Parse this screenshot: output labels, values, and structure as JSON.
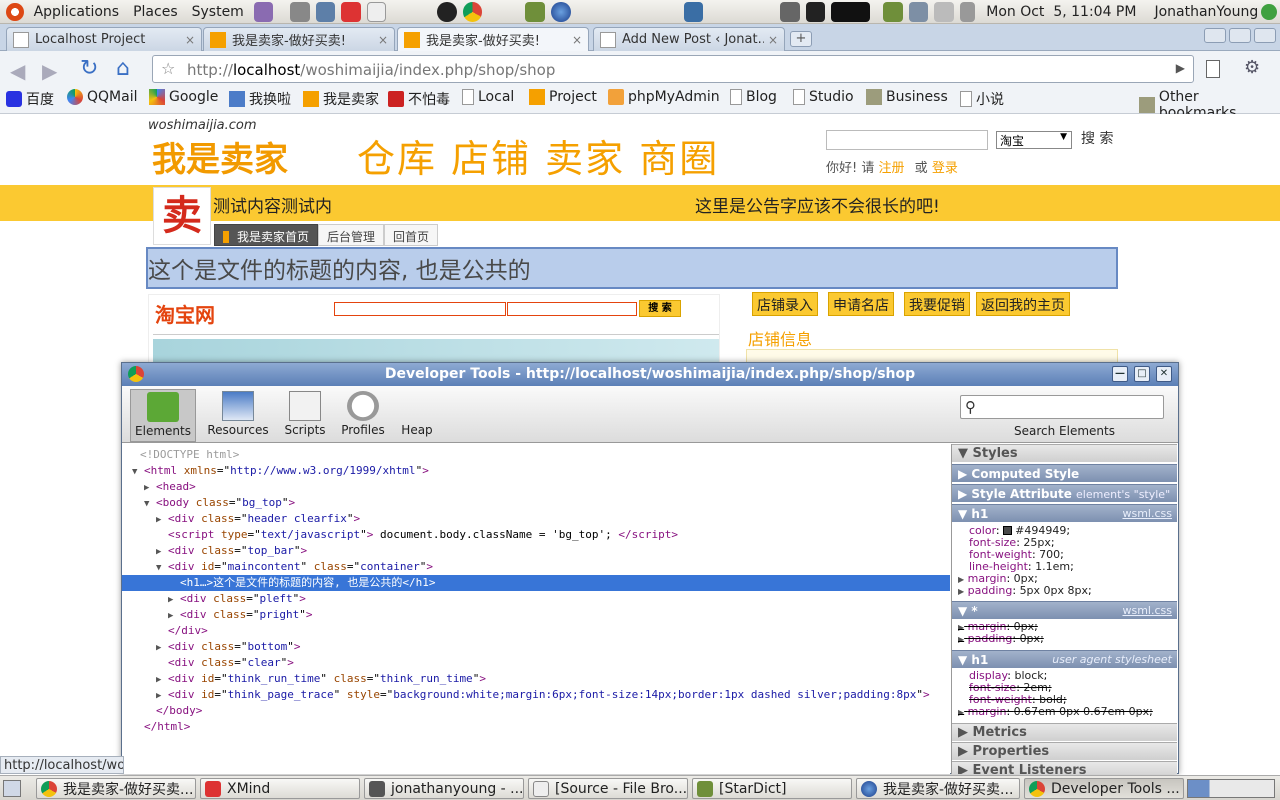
{
  "panel": {
    "menus": [
      "Applications",
      "Places",
      "System"
    ],
    "clock": "Mon Oct  5, 11:04 PM",
    "user": "JonathanYoung"
  },
  "tabs": [
    {
      "title": "Localhost Project",
      "close": "×"
    },
    {
      "title": "我是卖家-做好买卖!",
      "close": "×"
    },
    {
      "title": "我是卖家-做好买卖!",
      "close": "×"
    },
    {
      "title": "Add New Post ‹ Jonat…",
      "close": "×"
    }
  ],
  "omnibox": {
    "url_pre": "http://",
    "url_host": "localhost",
    "url_path": "/woshimaijia/index.php/shop/shop"
  },
  "bookmarks": [
    "百度",
    "QQMail",
    "Google",
    "我换啦",
    "我是卖家",
    "不怕毒",
    "Local",
    "Project",
    "phpMyAdmin",
    "Blog",
    "Studio",
    "Business",
    "小说"
  ],
  "other_bookmarks": "Other bookmarks",
  "site": {
    "logo_small": "woshimaijia.com",
    "logo_big": "我是卖家",
    "nav": "仓库 店铺 卖家 商圈",
    "search_select": "淘宝",
    "search_btn": "搜 索",
    "login_pre": "你好! 请",
    "register": "注册",
    "or": "或",
    "login": "登录",
    "shop_name": "测试内容测试内",
    "notice": "这里是公告字应该不会很长的吧!",
    "mai": "卖",
    "subtabs": [
      "我是卖家首页",
      "后台管理",
      "回首页"
    ],
    "h1": "这个是文件的标题的内容, 也是公共的",
    "taobao_logo": "淘宝网",
    "taobao_btn": "搜 索",
    "gold_buttons": [
      "店铺录入",
      "申请名店",
      "我要促销",
      "返回我的主页"
    ],
    "shop_info": "店铺信息"
  },
  "devtools": {
    "title": "Developer Tools - http://localhost/woshimaijia/index.php/shop/shop",
    "tools": [
      "Elements",
      "Resources",
      "Scripts",
      "Profiles",
      "Heap"
    ],
    "search_label": "Search Elements",
    "dom": [
      {
        "tw": "",
        "tag": "",
        "text": "<!DOCTYPE html>",
        "comment": true
      },
      {
        "tw": "▼",
        "tag": "html",
        "attrs": [
          [
            "xmlns",
            "http://www.w3.org/1999/xhtml"
          ]
        ]
      },
      {
        "tw": "▶",
        "tag": "head",
        "attrs": []
      },
      {
        "tw": "▼",
        "tag": "body",
        "attrs": [
          [
            "class",
            "bg_top"
          ]
        ]
      },
      {
        "tw": "▶",
        "tag": "div",
        "attrs": [
          [
            "class",
            "header clearfix"
          ]
        ]
      },
      {
        "tw": "",
        "tag": "script",
        "attrs": [
          [
            "type",
            "text/javascript"
          ]
        ],
        "inner": " document.body.className = 'bg_top'; ",
        "close": "script"
      },
      {
        "tw": "▶",
        "tag": "div",
        "attrs": [
          [
            "class",
            "top_bar"
          ]
        ]
      },
      {
        "tw": "▼",
        "tag": "div",
        "attrs": [
          [
            "id",
            "maincontent"
          ],
          [
            "class",
            "container"
          ]
        ]
      },
      {
        "tw": "",
        "tag": "h1",
        "attrs": [],
        "inner": "…>这个是文件的标题的内容, 也是公共的",
        "close": "h1"
      },
      {
        "tw": "▶",
        "tag": "div",
        "attrs": [
          [
            "class",
            "pleft"
          ]
        ]
      },
      {
        "tw": "▶",
        "tag": "div",
        "attrs": [
          [
            "class",
            "pright"
          ]
        ]
      },
      {
        "tw": "",
        "tag": "/div",
        "attrs": []
      },
      {
        "tw": "▶",
        "tag": "div",
        "attrs": [
          [
            "class",
            "bottom"
          ]
        ]
      },
      {
        "tw": "",
        "tag": "div",
        "attrs": [
          [
            "class",
            "clear"
          ]
        ]
      },
      {
        "tw": "▶",
        "tag": "div",
        "attrs": [
          [
            "id",
            "think_run_time"
          ],
          [
            "class",
            "think_run_time"
          ]
        ]
      },
      {
        "tw": "▶",
        "tag": "div",
        "attrs": [
          [
            "id",
            "think_page_trace"
          ],
          [
            "style",
            "background:white;margin:6px;font-size:14px;border:1px dashed silver;padding:8px"
          ]
        ]
      },
      {
        "tw": "",
        "tag": "/body",
        "attrs": []
      },
      {
        "tw": "",
        "tag": "/html",
        "attrs": []
      }
    ],
    "sidebar": {
      "styles": "Styles",
      "computed": "Computed Style",
      "style_attr": "Style Attribute",
      "style_attr_sub": "element's \"style\" a…",
      "rule1": {
        "sel": "h1",
        "src": "wsml.css",
        "props": [
          [
            "color",
            "#494949"
          ],
          [
            "font-size",
            "25px"
          ],
          [
            "font-weight",
            "700"
          ],
          [
            "line-height",
            "1.1em"
          ],
          [
            "margin",
            "0px"
          ],
          [
            "padding",
            "5px 0px 8px"
          ]
        ]
      },
      "rule2": {
        "sel": "*",
        "src": "wsml.css",
        "props": [
          [
            "margin",
            "0px"
          ],
          [
            "padding",
            "0px"
          ]
        ]
      },
      "rule3": {
        "sel": "h1",
        "src": "user agent stylesheet",
        "props": [
          [
            "display",
            "block"
          ],
          [
            "font-size",
            "2em"
          ],
          [
            "font-weight",
            "bold"
          ],
          [
            "margin",
            "0.67em 0px 0.67em 0px"
          ]
        ]
      },
      "metrics": "Metrics",
      "properties": "Properties",
      "events": "Event Listeners"
    }
  },
  "status_url": "http://localhost/wo",
  "taskbar": [
    "我是卖家-做好买卖...",
    "XMind",
    "jonathanyoung - ...",
    "[Source - File Bro...",
    "[StarDict]",
    "我是卖家-做好买卖...",
    "Developer Tools ..."
  ],
  "colors": {
    "accent": "#fbc931",
    "orange": "#f5a000",
    "select": "#3875d7"
  }
}
